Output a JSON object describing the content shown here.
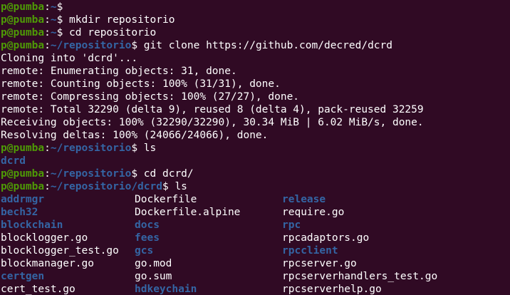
{
  "prompt": {
    "user_host": "p@pumba",
    "colon": ":",
    "home": "~",
    "repo": "~/repositorio",
    "repo_dcrd": "~/repositorio/dcrd",
    "symbol": "$"
  },
  "commands": {
    "c1": " mkdir repositorio",
    "c2": " cd repositorio",
    "c3": " git clone https://github.com/decred/dcrd",
    "c4": " ls",
    "c5": " cd dcrd/",
    "c6": " ls"
  },
  "output": {
    "clone": [
      "Cloning into 'dcrd'...",
      "remote: Enumerating objects: 31, done.",
      "remote: Counting objects: 100% (31/31), done.",
      "remote: Compressing objects: 100% (27/27), done.",
      "remote: Total 32290 (delta 9), reused 8 (delta 4), pack-reused 32259",
      "Receiving objects: 100% (32290/32290), 30.34 MiB | 6.02 MiB/s, done.",
      "Resolving deltas: 100% (24066/24066), done."
    ],
    "ls1": "dcrd",
    "ls2": [
      [
        {
          "t": "addrmgr",
          "d": true
        },
        {
          "t": "Dockerfile",
          "d": false
        },
        {
          "t": "release",
          "d": true
        }
      ],
      [
        {
          "t": "bech32",
          "d": true
        },
        {
          "t": "Dockerfile.alpine",
          "d": false
        },
        {
          "t": "require.go",
          "d": false
        }
      ],
      [
        {
          "t": "blockchain",
          "d": true
        },
        {
          "t": "docs",
          "d": true
        },
        {
          "t": "rpc",
          "d": true
        }
      ],
      [
        {
          "t": "blocklogger.go",
          "d": false
        },
        {
          "t": "fees",
          "d": true
        },
        {
          "t": "rpcadaptors.go",
          "d": false
        }
      ],
      [
        {
          "t": "blocklogger_test.go",
          "d": false
        },
        {
          "t": "gcs",
          "d": true
        },
        {
          "t": "rpcclient",
          "d": true
        }
      ],
      [
        {
          "t": "blockmanager.go",
          "d": false
        },
        {
          "t": "go.mod",
          "d": false
        },
        {
          "t": "rpcserver.go",
          "d": false
        }
      ],
      [
        {
          "t": "certgen",
          "d": true
        },
        {
          "t": "go.sum",
          "d": false
        },
        {
          "t": "rpcserverhandlers_test.go",
          "d": false
        }
      ],
      [
        {
          "t": "cert_test.go",
          "d": false
        },
        {
          "t": "hdkeychain",
          "d": true
        },
        {
          "t": "rpcserverhelp.go",
          "d": false
        }
      ]
    ]
  },
  "colors": {
    "background": "#300a24",
    "prompt_user": "#4e9a06",
    "prompt_path": "#3465a4",
    "directory": "#3465a4",
    "text": "#ffffff"
  }
}
